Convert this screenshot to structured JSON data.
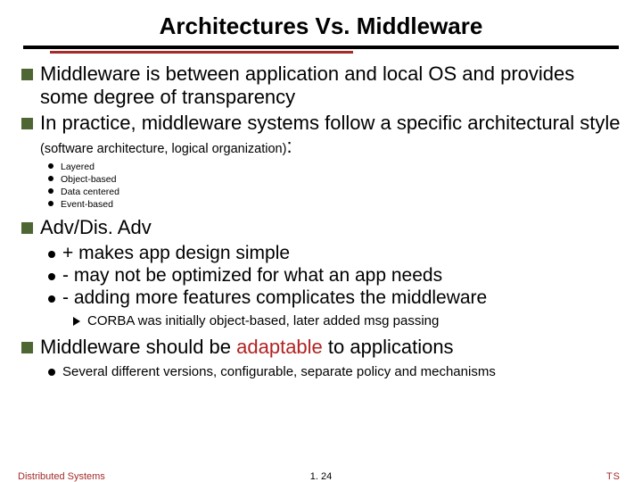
{
  "title": "Architectures Vs. Middleware",
  "bullets": {
    "b1": "Middleware is between application and local OS and provides some degree of transparency",
    "b2_a": "In practice, middleware systems follow a specific architectural style ",
    "b2_b": "(software architecture, logical organization)",
    "b2_c": ":",
    "styles": [
      "Layered",
      "Object-based",
      "Data centered",
      "Event-based"
    ],
    "b3": "Adv/Dis. Adv",
    "adv": [
      "+ makes app design simple",
      "- may not be optimized for what an app needs",
      "- adding more features complicates the middleware"
    ],
    "corba": "CORBA was initially object-based, later added msg passing",
    "b4_a": "Middleware should be ",
    "b4_b": "adaptable",
    "b4_c": " to applications",
    "b4_sub": "Several different versions, configurable, separate policy and mechanisms"
  },
  "footer": {
    "left": "Distributed Systems",
    "center": "1. 24",
    "right": "TS"
  }
}
